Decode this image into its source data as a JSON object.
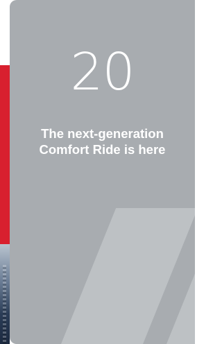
{
  "card": {
    "number": "20",
    "headline_line1": "The next-generation",
    "headline_line2": "Comfort Ride is here"
  },
  "colors": {
    "card_background": "#a8acb0",
    "slash_shape": "#bdc1c4",
    "neighbor_card_red": "#d8202f",
    "text": "#ffffff"
  }
}
